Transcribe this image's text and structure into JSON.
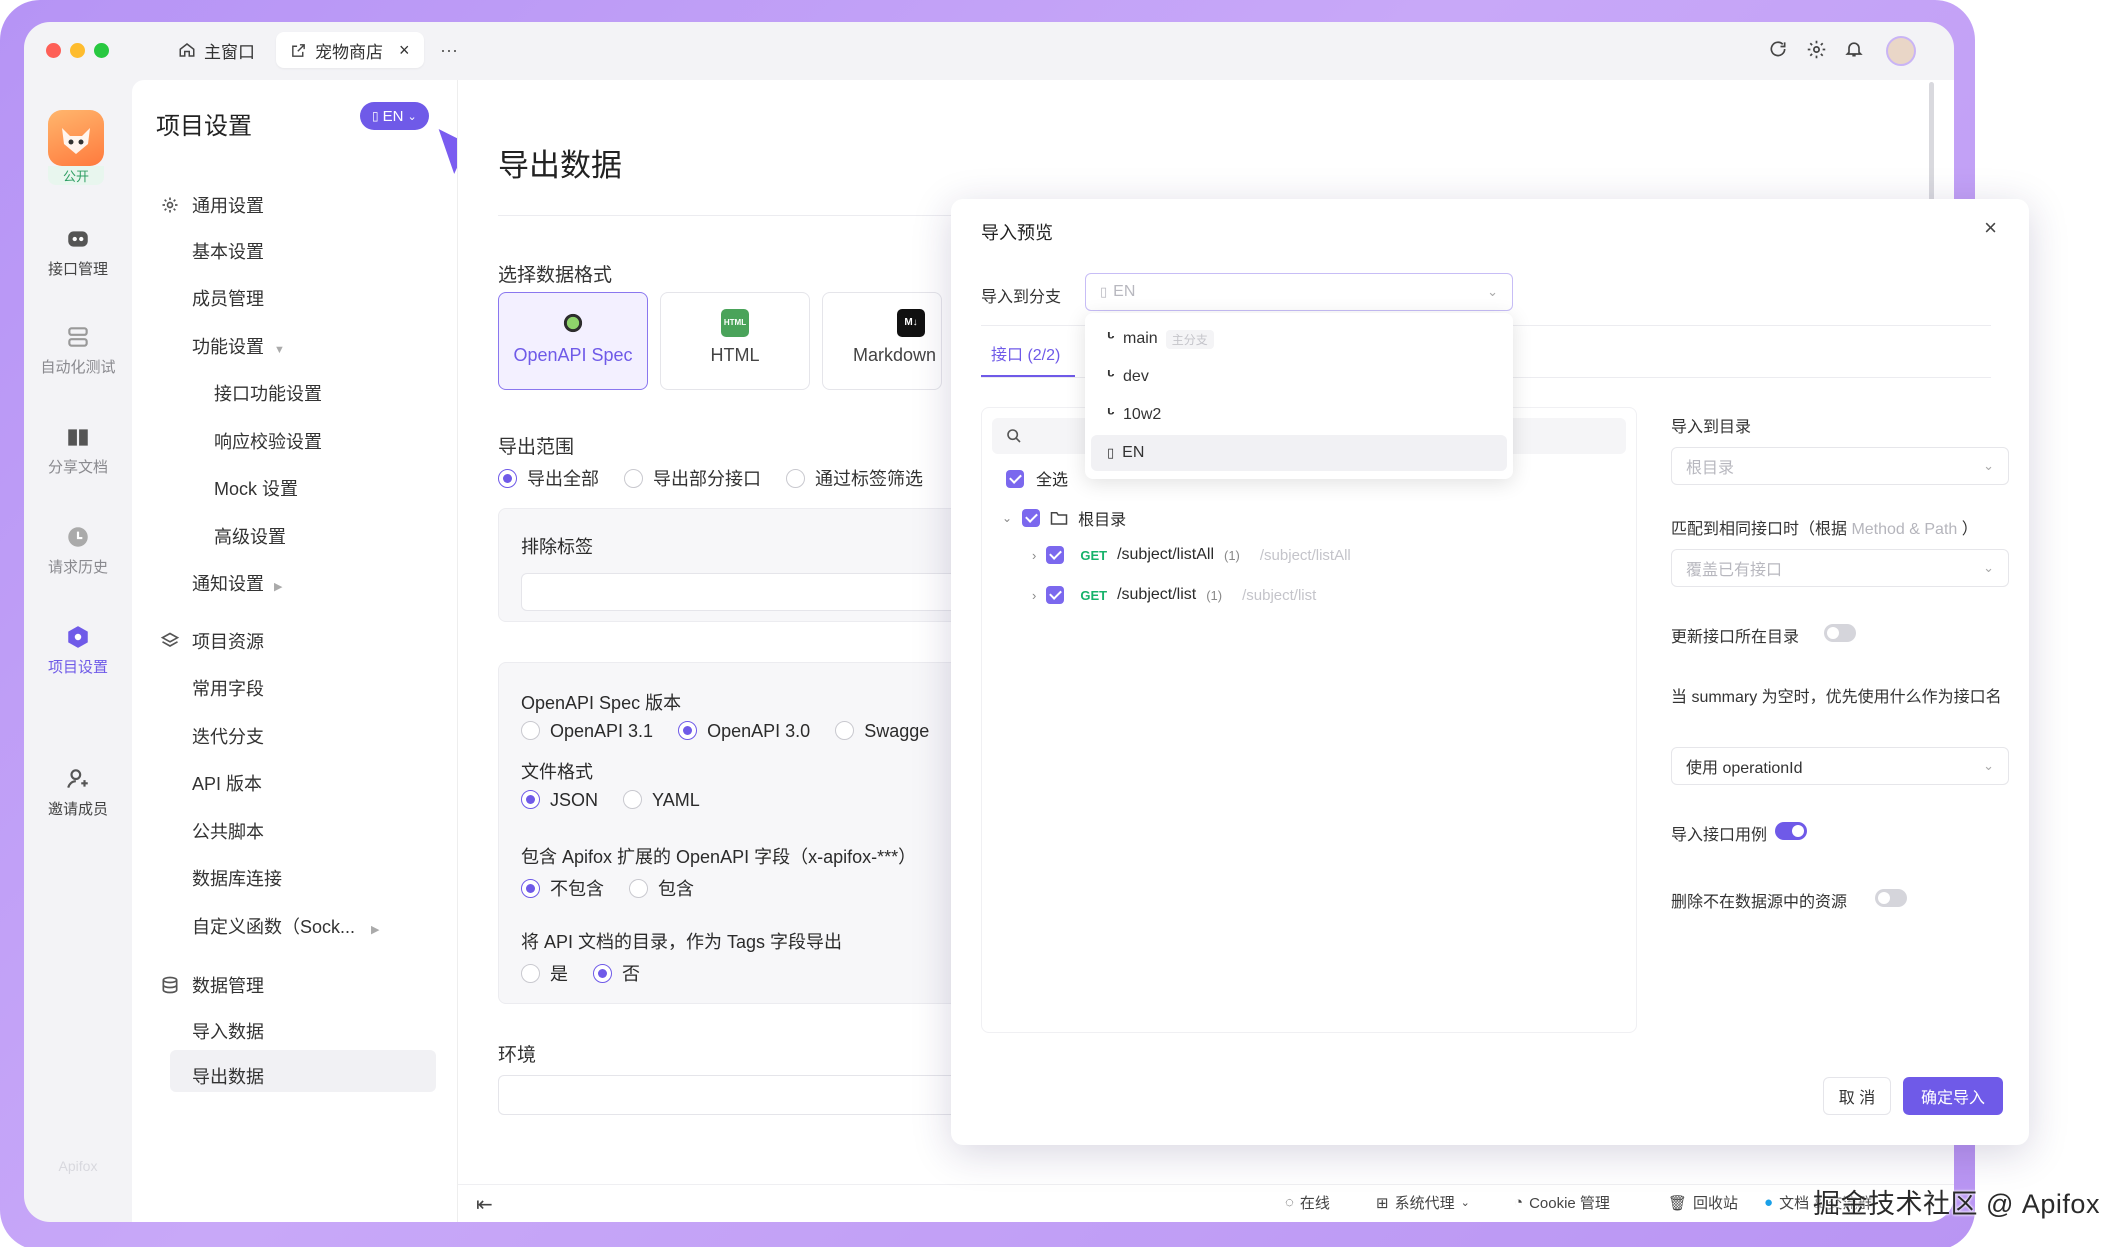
{
  "window": {
    "tabs": [
      {
        "label": "主窗口"
      },
      {
        "label": "宠物商店"
      }
    ],
    "more": "···"
  },
  "rail": {
    "public_badge": "公开",
    "items": [
      {
        "label": "接口管理",
        "icon": "api-icon"
      },
      {
        "label": "自动化测试",
        "icon": "layers-icon"
      },
      {
        "label": "分享文档",
        "icon": "book-icon"
      },
      {
        "label": "请求历史",
        "icon": "clock-icon"
      },
      {
        "label": "项目设置",
        "icon": "hexagon-icon"
      },
      {
        "label": "邀请成员",
        "icon": "user-plus-icon"
      }
    ],
    "footer_logo": "Apifox"
  },
  "sidebar": {
    "title": "项目设置",
    "branch_badge": "EN",
    "groups": [
      {
        "label": "通用设置",
        "items": [
          "基本设置",
          "成员管理",
          "功能设置",
          "接口功能设置",
          "响应校验设置",
          "Mock 设置",
          "高级设置",
          "通知设置"
        ]
      },
      {
        "label": "项目资源",
        "items": [
          "常用字段",
          "迭代分支",
          "API 版本",
          "公共脚本",
          "数据库连接",
          "自定义函数（Sock..."
        ]
      },
      {
        "label": "数据管理",
        "items": [
          "导入数据",
          "导出数据"
        ]
      }
    ]
  },
  "main": {
    "title": "导出数据",
    "format_label": "选择数据格式",
    "formats": [
      "OpenAPI Spec",
      "HTML",
      "Markdown"
    ],
    "scope_label": "导出范围",
    "scope_options": [
      "导出全部",
      "导出部分接口",
      "通过标签筛选"
    ],
    "exclude_tags_label": "排除标签",
    "spec_version_label": "OpenAPI Spec 版本",
    "spec_versions": [
      "OpenAPI 3.1",
      "OpenAPI 3.0",
      "Swagge"
    ],
    "file_format_label": "文件格式",
    "file_formats": [
      "JSON",
      "YAML"
    ],
    "apifox_ext_label": "包含 Apifox 扩展的 OpenAPI 字段（x-apifox-***）",
    "apifox_ext_options": [
      "不包含",
      "包含"
    ],
    "tags_label": "将 API 文档的目录，作为 Tags 字段导出",
    "tags_options": [
      "是",
      "否"
    ],
    "env_label": "环境"
  },
  "dialog": {
    "title": "导入预览",
    "branch_label": "导入到分支",
    "branch_value": "EN",
    "tab_label": "接口 (2/2)",
    "select_all": "全选",
    "root_folder": "根目录",
    "endpoints": [
      {
        "method": "GET",
        "path": "/subject/listAll",
        "count": "(1)",
        "hint": "/subject/listAll"
      },
      {
        "method": "GET",
        "path": "/subject/list",
        "count": "(1)",
        "hint": "/subject/list"
      }
    ],
    "target_dir_label": "导入到目录",
    "target_dir_value": "根目录",
    "match_label_pre": "匹配到相同接口时（根据 ",
    "match_label_hint": "Method & Path",
    "match_label_post": " ）",
    "match_value": "覆盖已有接口",
    "update_dir_label": "更新接口所在目录",
    "summary_label": "当 summary 为空时，优先使用什么作为接口名",
    "summary_value": "使用 operationId",
    "import_cases_label": "导入接口用例",
    "delete_missing_label": "删除不在数据源中的资源",
    "cancel": "取 消",
    "confirm": "确定导入",
    "branch_dropdown": [
      {
        "label": "main",
        "tag": "主分支"
      },
      {
        "label": "dev",
        "tag": ""
      },
      {
        "label": "10w2",
        "tag": ""
      },
      {
        "label": "EN",
        "tag": ""
      }
    ]
  },
  "statusbar": {
    "online": "在线",
    "proxy": "系统代理",
    "cookie": "Cookie 管理",
    "trash": "回收站",
    "docs": "文档 & 交流群"
  },
  "watermark": "掘金技术社区 @ Apifox",
  "colors": {
    "accent": "#6f5ae8",
    "get": "#17b26a",
    "frame": "#b694f5"
  }
}
